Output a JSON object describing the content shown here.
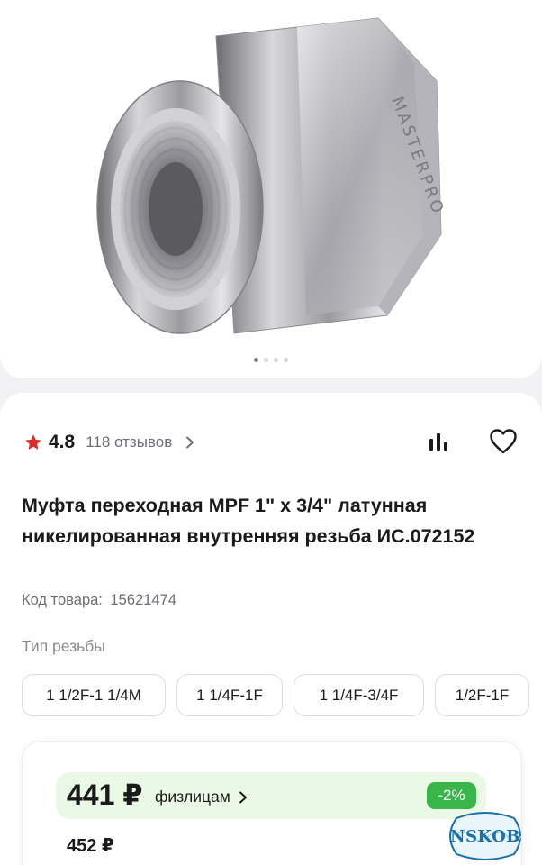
{
  "gallery": {
    "engraving": "MASTERPRO",
    "dots": 4,
    "active_dot": 1
  },
  "rating": {
    "value": "4.8",
    "reviews": "118 отзывов",
    "star_color": "#d32f2f"
  },
  "product": {
    "title": "Муфта переходная MPF 1\" x 3/4\" латунная никелированная внутренняя резьба ИС.072152",
    "sku_label": "Код товара:",
    "sku_value": "15621474"
  },
  "thread": {
    "label": "Тип резьбы",
    "options": [
      "1 1/2F-1 1/4M",
      "1 1/4F-1F",
      "1 1/4F-3/4F",
      "1/2F-1F"
    ]
  },
  "price": {
    "current": "441 ₽",
    "audience": "физлицам",
    "discount": "-2%",
    "old": "452 ₽",
    "accent": "#39b54a"
  },
  "watermark": {
    "text": "NSKOB",
    "color": "#1d6fa8"
  }
}
